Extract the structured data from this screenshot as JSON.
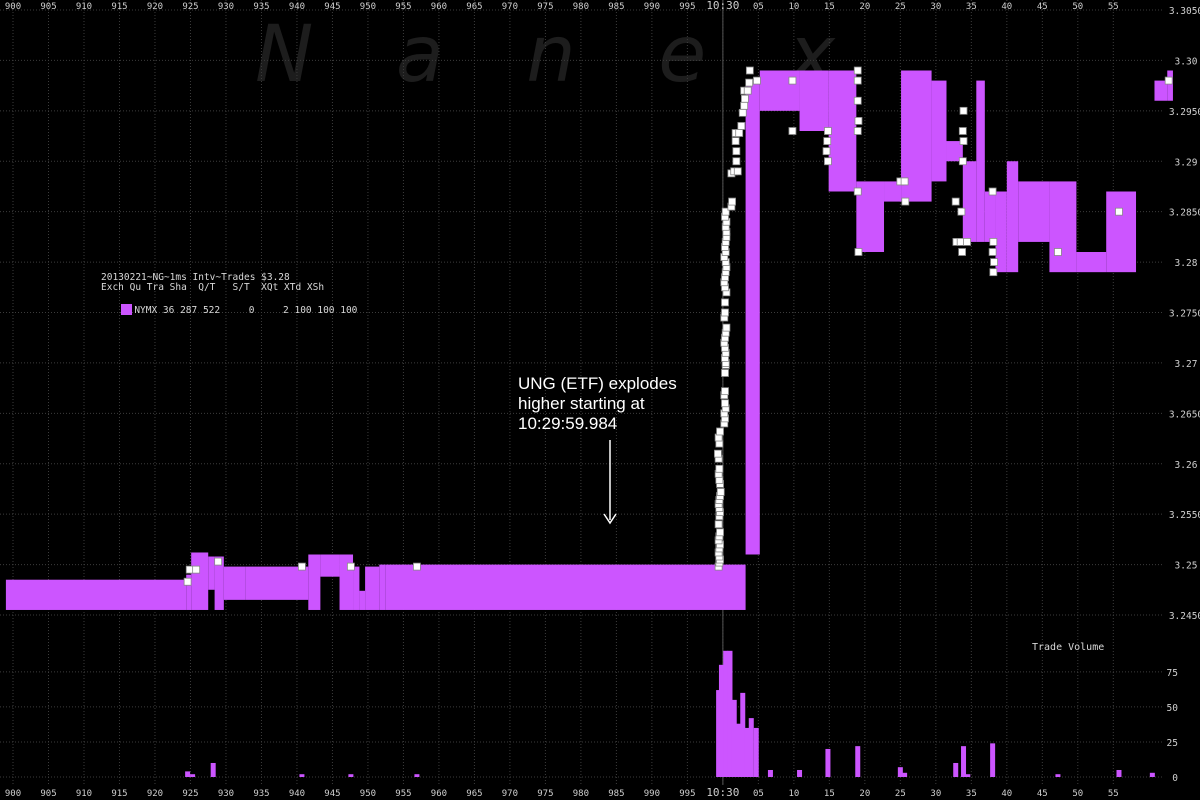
{
  "watermark": "Nanex",
  "legend": {
    "title": "20130221~NG~1ms Intv~Trades $3.28",
    "header": "Exch Qu Tra Sha  Q/T   S/T  XQt XTd XSh",
    "row": "NYMX 36 287 522     0     2 100 100 100",
    "swatch_color": "#cc55ff"
  },
  "annotation": {
    "lines": [
      "UNG (ETF) explodes",
      "higher starting at",
      "10:29:59.984"
    ]
  },
  "volume_title": "Trade Volume",
  "chart_data": [
    {
      "type": "area",
      "title": "",
      "xlabel": "",
      "ylabel": "",
      "x_tick_labels": [
        "900",
        "905",
        "910",
        "915",
        "920",
        "925",
        "930",
        "935",
        "940",
        "945",
        "950",
        "955",
        "960",
        "965",
        "970",
        "975",
        "980",
        "985",
        "990",
        "995",
        "10:30",
        "05",
        "10",
        "15",
        "20",
        "25",
        "30",
        "35",
        "40",
        "45",
        "50",
        "55"
      ],
      "x_tick_positions": [
        0,
        5,
        10,
        15,
        20,
        25,
        30,
        35,
        40,
        45,
        50,
        55,
        60,
        65,
        70,
        75,
        80,
        85,
        90,
        95,
        100,
        105,
        110,
        115,
        120,
        125,
        130,
        135,
        140,
        145,
        150,
        155
      ],
      "xlim": [
        -1.3,
        166
      ],
      "y_tick_labels": [
        "3.3050",
        "3.30",
        "3.2950",
        "3.29",
        "3.2850",
        "3.28",
        "3.2750",
        "3.27",
        "3.2650",
        "3.26",
        "3.2550",
        "3.25",
        "3.2450"
      ],
      "ylim": [
        3.2425,
        3.305
      ],
      "colors": {
        "range": "#cc55ff",
        "trade": "#ffffff",
        "grid": "#3c3c3c",
        "axis_text": "#cfcfcf"
      },
      "series": [
        {
          "kind": "bid-ask-range",
          "segments": [
            [
              -1,
              24.4,
              3.2455,
              3.2485
            ],
            [
              24.4,
              25.1,
              3.2455,
              3.249
            ],
            [
              25.1,
              27.5,
              3.2455,
              3.2512
            ],
            [
              27.5,
              28.4,
              3.2475,
              3.2508
            ],
            [
              28.4,
              29.7,
              3.2455,
              3.2508
            ],
            [
              29.7,
              32.8,
              3.2465,
              3.2498
            ],
            [
              32.8,
              41.6,
              3.2465,
              3.2498
            ],
            [
              41.6,
              43.3,
              3.2455,
              3.251
            ],
            [
              43.3,
              46.0,
              3.2488,
              3.251
            ],
            [
              46.0,
              47.9,
              3.2455,
              3.251
            ],
            [
              47.9,
              48.8,
              3.2455,
              3.2498
            ],
            [
              48.8,
              49.6,
              3.2455,
              3.2474
            ],
            [
              49.6,
              51.6,
              3.2455,
              3.2498
            ],
            [
              51.6,
              52.5,
              3.2455,
              3.25
            ],
            [
              52.5,
              103.2,
              3.2455,
              3.25
            ],
            [
              103.2,
              105.2,
              3.251,
              3.298
            ],
            [
              105.2,
              110.8,
              3.295,
              3.299
            ],
            [
              110.8,
              114.9,
              3.293,
              3.299
            ],
            [
              114.9,
              118.8,
              3.287,
              3.299
            ],
            [
              118.8,
              122.7,
              3.281,
              3.288
            ],
            [
              122.7,
              125.1,
              3.286,
              3.288
            ],
            [
              125.1,
              129.4,
              3.286,
              3.299
            ],
            [
              129.4,
              131.5,
              3.288,
              3.298
            ],
            [
              131.5,
              133.8,
              3.29,
              3.292
            ],
            [
              133.8,
              135.7,
              3.282,
              3.29
            ],
            [
              135.7,
              136.9,
              3.282,
              3.298
            ],
            [
              136.9,
              138.4,
              3.282,
              3.287
            ],
            [
              138.4,
              140.0,
              3.279,
              3.287
            ],
            [
              140.0,
              141.6,
              3.279,
              3.29
            ],
            [
              141.6,
              146.0,
              3.282,
              3.288
            ],
            [
              146.0,
              149.8,
              3.279,
              3.288
            ],
            [
              149.8,
              154.0,
              3.279,
              3.281
            ],
            [
              154.0,
              158.2,
              3.279,
              3.287
            ],
            [
              160.8,
              162.6,
              3.296,
              3.298
            ],
            [
              162.6,
              163.4,
              3.296,
              3.299
            ]
          ]
        },
        {
          "kind": "trades",
          "points": [
            [
              24.6,
              3.2483
            ],
            [
              24.9,
              3.2495
            ],
            [
              25.8,
              3.2495
            ],
            [
              28.9,
              3.2503
            ],
            [
              40.7,
              3.2498
            ],
            [
              47.6,
              3.2498
            ],
            [
              56.9,
              3.2498
            ],
            [
              99.4,
              3.2498
            ],
            [
              99.5,
              3.2502
            ],
            [
              99.6,
              3.2505
            ],
            [
              99.5,
              3.2508
            ],
            [
              99.4,
              3.2512
            ],
            [
              99.5,
              3.2516
            ],
            [
              99.6,
              3.252
            ],
            [
              99.4,
              3.2524
            ],
            [
              99.5,
              3.2528
            ],
            [
              99.6,
              3.2532
            ],
            [
              99.4,
              3.254
            ],
            [
              99.5,
              3.2548
            ],
            [
              99.6,
              3.2552
            ],
            [
              99.5,
              3.2556
            ],
            [
              99.4,
              3.256
            ],
            [
              99.5,
              3.2564
            ],
            [
              99.6,
              3.2568
            ],
            [
              99.7,
              3.2572
            ],
            [
              99.6,
              3.258
            ],
            [
              99.5,
              3.2584
            ],
            [
              99.4,
              3.259
            ],
            [
              99.5,
              3.2595
            ],
            [
              99.4,
              3.2605
            ],
            [
              99.3,
              3.261
            ],
            [
              99.5,
              3.262
            ],
            [
              99.4,
              3.2626
            ],
            [
              99.6,
              3.2632
            ],
            [
              100.2,
              3.264
            ],
            [
              100.3,
              3.2645
            ],
            [
              100.2,
              3.265
            ],
            [
              100.4,
              3.2655
            ],
            [
              100.3,
              3.266
            ],
            [
              100.2,
              3.2668
            ],
            [
              100.3,
              3.2672
            ],
            [
              100.3,
              3.269
            ],
            [
              100.4,
              3.2698
            ],
            [
              100.4,
              3.27
            ],
            [
              100.3,
              3.2705
            ],
            [
              100.4,
              3.271
            ],
            [
              100.3,
              3.2715
            ],
            [
              100.2,
              3.272
            ],
            [
              100.3,
              3.2725
            ],
            [
              100.4,
              3.273
            ],
            [
              100.5,
              3.2735
            ],
            [
              100.2,
              3.2745
            ],
            [
              100.3,
              3.275
            ],
            [
              100.3,
              3.276
            ],
            [
              100.5,
              3.277
            ],
            [
              100.3,
              3.2775
            ],
            [
              100.2,
              3.278
            ],
            [
              100.3,
              3.2785
            ],
            [
              100.4,
              3.279
            ],
            [
              100.5,
              3.2795
            ],
            [
              100.4,
              3.28
            ],
            [
              100.2,
              3.2805
            ],
            [
              100.4,
              3.281
            ],
            [
              100.3,
              3.2815
            ],
            [
              100.4,
              3.282
            ],
            [
              100.5,
              3.2825
            ],
            [
              100.5,
              3.283
            ],
            [
              100.4,
              3.2835
            ],
            [
              100.5,
              3.284
            ],
            [
              100.3,
              3.2845
            ],
            [
              100.4,
              3.285
            ],
            [
              101.2,
              3.2855
            ],
            [
              101.3,
              3.286
            ],
            [
              101.2,
              3.2888
            ],
            [
              101.6,
              3.289
            ],
            [
              102.1,
              3.289
            ],
            [
              101.9,
              3.29
            ],
            [
              101.9,
              3.291
            ],
            [
              101.8,
              3.292
            ],
            [
              101.8,
              3.2928
            ],
            [
              102.3,
              3.2928
            ],
            [
              102.6,
              3.2935
            ],
            [
              102.8,
              3.2948
            ],
            [
              103.0,
              3.2955
            ],
            [
              103.1,
              3.2962
            ],
            [
              103.0,
              3.297
            ],
            [
              103.5,
              3.297
            ],
            [
              103.7,
              3.2978
            ],
            [
              103.8,
              3.299
            ],
            [
              104.8,
              3.298
            ],
            [
              109.8,
              3.298
            ],
            [
              109.8,
              3.293
            ],
            [
              114.8,
              3.293
            ],
            [
              114.7,
              3.292
            ],
            [
              114.6,
              3.291
            ],
            [
              114.8,
              3.29
            ],
            [
              119.0,
              3.298
            ],
            [
              119.0,
              3.299
            ],
            [
              119.0,
              3.296
            ],
            [
              119.1,
              3.294
            ],
            [
              119.0,
              3.293
            ],
            [
              119.0,
              3.287
            ],
            [
              119.1,
              3.281
            ],
            [
              125.0,
              3.288
            ],
            [
              125.6,
              3.288
            ],
            [
              125.7,
              3.286
            ],
            [
              132.8,
              3.286
            ],
            [
              132.9,
              3.282
            ],
            [
              133.8,
              3.293
            ],
            [
              133.9,
              3.292
            ],
            [
              133.8,
              3.29
            ],
            [
              133.9,
              3.295
            ],
            [
              133.6,
              3.285
            ],
            [
              133.7,
              3.281
            ],
            [
              133.5,
              3.282
            ],
            [
              134.4,
              3.282
            ],
            [
              138.1,
              3.282
            ],
            [
              138.0,
              3.281
            ],
            [
              138.2,
              3.28
            ],
            [
              138.1,
              3.279
            ],
            [
              138.0,
              3.287
            ],
            [
              147.2,
              3.281
            ],
            [
              155.8,
              3.285
            ],
            [
              162.8,
              3.298
            ]
          ]
        }
      ]
    },
    {
      "type": "bar",
      "title": "Trade Volume",
      "y_tick_labels": [
        "0",
        "25",
        "50",
        "75"
      ],
      "ylim": [
        0,
        92
      ],
      "color": "#cc55ff",
      "bars": [
        [
          24.6,
          4
        ],
        [
          25.3,
          2
        ],
        [
          28.2,
          10
        ],
        [
          40.7,
          2
        ],
        [
          47.6,
          2
        ],
        [
          56.9,
          2
        ],
        [
          99.4,
          62
        ],
        [
          99.8,
          80
        ],
        [
          100.4,
          90
        ],
        [
          101.0,
          90
        ],
        [
          101.6,
          55
        ],
        [
          102.2,
          38
        ],
        [
          102.8,
          60
        ],
        [
          103.4,
          35
        ],
        [
          104.0,
          42
        ],
        [
          104.7,
          35
        ],
        [
          106.7,
          5
        ],
        [
          110.8,
          5
        ],
        [
          114.8,
          20
        ],
        [
          119.0,
          22
        ],
        [
          125.0,
          7
        ],
        [
          125.6,
          3
        ],
        [
          132.8,
          10
        ],
        [
          133.9,
          22
        ],
        [
          134.5,
          2
        ],
        [
          138.0,
          24
        ],
        [
          147.2,
          2
        ],
        [
          155.8,
          5
        ],
        [
          160.5,
          3
        ]
      ]
    }
  ]
}
